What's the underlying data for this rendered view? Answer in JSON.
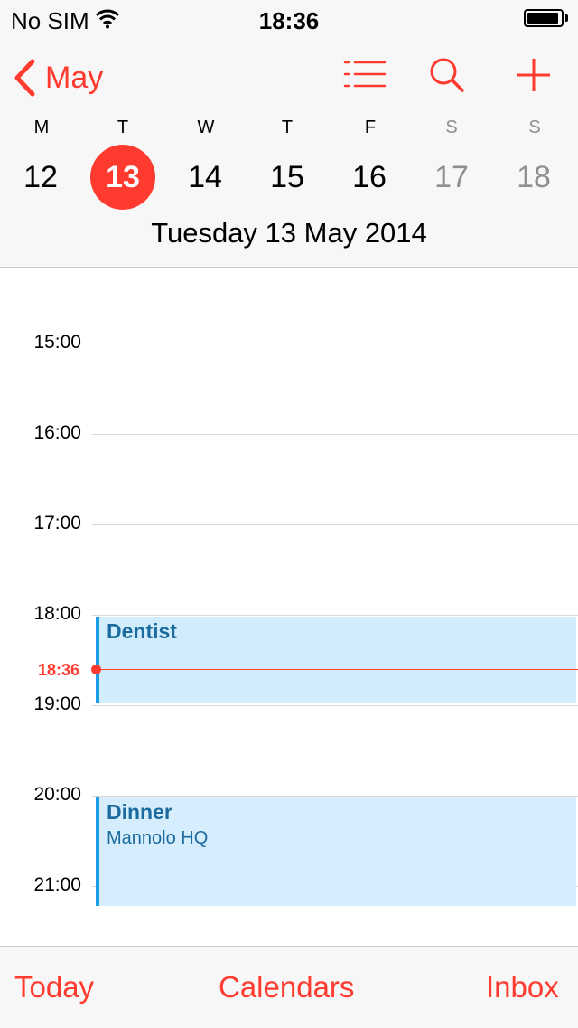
{
  "status_bar": {
    "carrier": "No SIM",
    "time": "18:36",
    "wifi_icon": "wifi-icon",
    "battery_icon": "battery-icon"
  },
  "nav": {
    "back_label": "May",
    "icons": [
      "list-icon",
      "search-icon",
      "add-icon"
    ]
  },
  "week": {
    "days": [
      {
        "letter": "M",
        "date": "12"
      },
      {
        "letter": "T",
        "date": "13"
      },
      {
        "letter": "W",
        "date": "14"
      },
      {
        "letter": "T",
        "date": "15"
      },
      {
        "letter": "F",
        "date": "16"
      },
      {
        "letter": "S",
        "date": "17"
      },
      {
        "letter": "S",
        "date": "18"
      }
    ],
    "selected_date": "13",
    "full_date": "Tuesday  13 May 2014"
  },
  "timeline": {
    "hours": [
      "15:00",
      "16:00",
      "17:00",
      "18:00",
      "19:00",
      "20:00",
      "21:00"
    ],
    "current_time": "18:36",
    "events": [
      {
        "title": "Dentist",
        "location": "",
        "start": "18:00",
        "end": "19:00"
      },
      {
        "title": "Dinner",
        "location": "Mannolo HQ",
        "start": "20:00",
        "end": "21:15"
      }
    ]
  },
  "tabs": {
    "today": "Today",
    "calendars": "Calendars",
    "inbox": "Inbox"
  },
  "colors": {
    "accent": "#ff3b30",
    "event_bg": "#d1ecfc",
    "event_bar": "#1c9be6",
    "event_text": "#1b6b9e",
    "weekend_text": "#8e8e93"
  }
}
